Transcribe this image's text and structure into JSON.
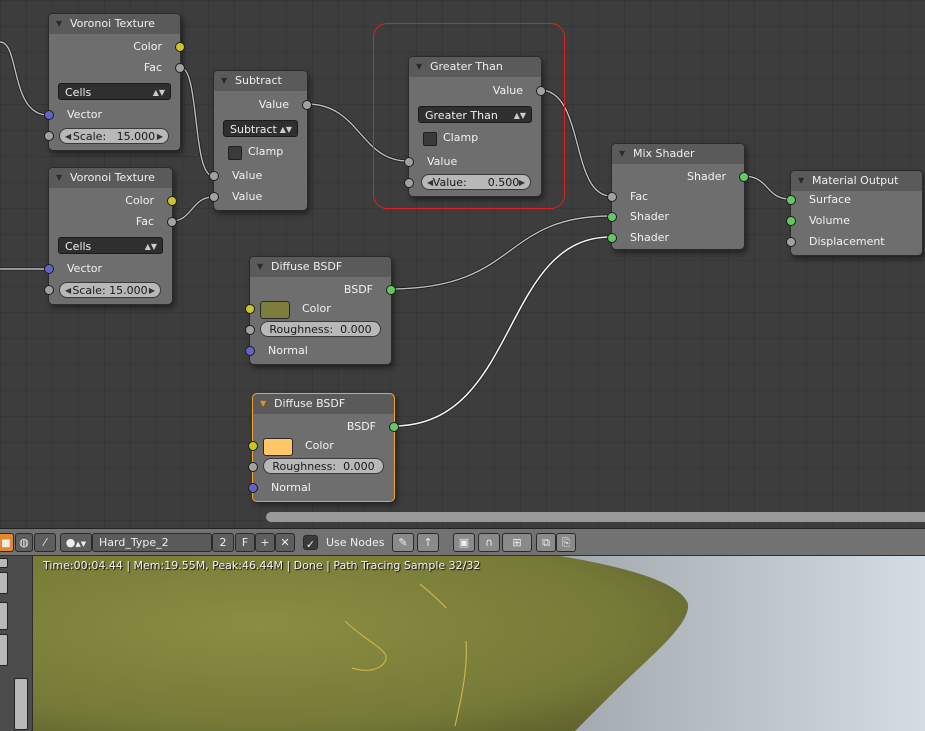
{
  "nodes": {
    "voronoi1": {
      "title": "Voronoi Texture",
      "out_color": "Color",
      "out_fac": "Fac",
      "coloring": "Cells",
      "in_vector": "Vector",
      "scale_label": "Scale:",
      "scale_value": "15.000"
    },
    "voronoi2": {
      "title": "Voronoi Texture",
      "out_color": "Color",
      "out_fac": "Fac",
      "coloring": "Cells",
      "in_vector": "Vector",
      "scale_label": "Scale:",
      "scale_value": "15.000"
    },
    "subtract": {
      "title": "Subtract",
      "out_value": "Value",
      "operation": "Subtract",
      "clamp": "Clamp",
      "in_value1": "Value",
      "in_value2": "Value"
    },
    "greater": {
      "title": "Greater Than",
      "out_value": "Value",
      "operation": "Greater Than",
      "clamp": "Clamp",
      "in_value": "Value",
      "value_label": "Value:",
      "value": "0.500"
    },
    "mix": {
      "title": "Mix Shader",
      "out_shader": "Shader",
      "in_fac": "Fac",
      "in_shader1": "Shader",
      "in_shader2": "Shader"
    },
    "output": {
      "title": "Material Output",
      "in_surface": "Surface",
      "in_volume": "Volume",
      "in_displacement": "Displacement"
    },
    "diffuse1": {
      "title": "Diffuse BSDF",
      "out_bsdf": "BSDF",
      "color_label": "Color",
      "color": "#7f7d3c",
      "roughness_label": "Roughness:",
      "roughness": "0.000",
      "normal": "Normal"
    },
    "diffuse2": {
      "title": "Diffuse BSDF",
      "out_bsdf": "BSDF",
      "color_label": "Color",
      "color": "#ffc766",
      "roughness_label": "Roughness:",
      "roughness": "0.000",
      "normal": "Normal"
    }
  },
  "toolbar": {
    "material_name": "Hard_Type_2",
    "users": "2",
    "fake_user": "F",
    "use_nodes_label": "Use Nodes",
    "use_nodes_checked": true
  },
  "render": {
    "status": "Time:00:04.44 | Mem:19.55M, Peak:46.44M | Done | Path Tracing Sample 32/32"
  },
  "colors": {
    "accent": "#f0a030",
    "selection": "#e02020",
    "socket_color": "#c7c729",
    "socket_shader": "#63c763",
    "socket_vector": "#6363c7",
    "socket_value": "#a1a1a1",
    "surface": "#7b7e3a"
  }
}
